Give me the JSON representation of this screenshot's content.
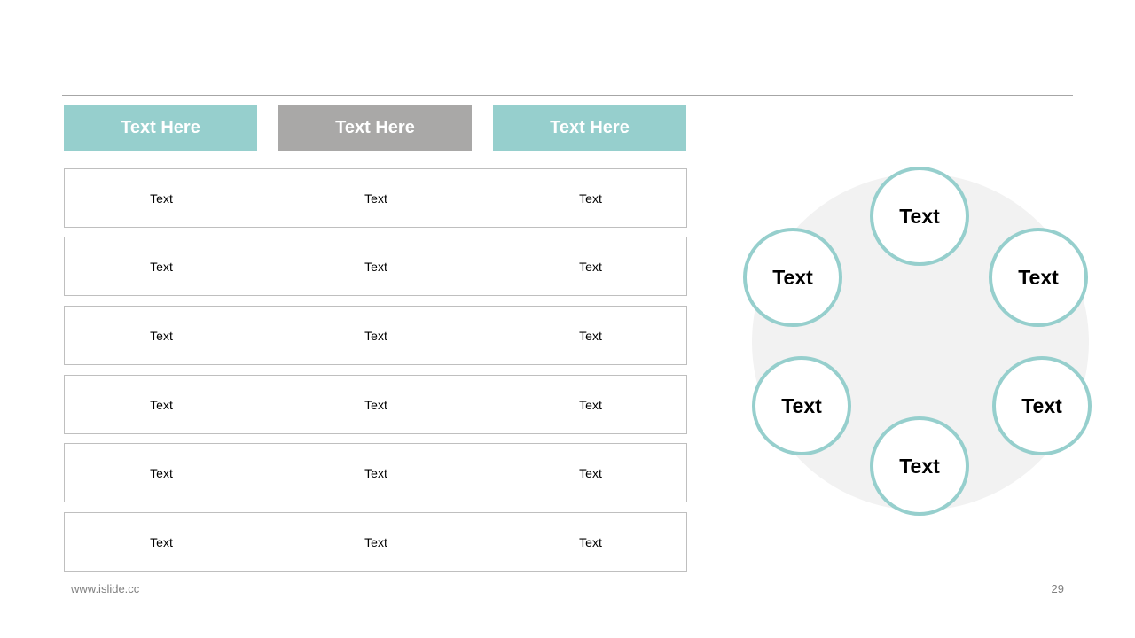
{
  "colors": {
    "teal": "#96cfcd",
    "gray": "#a9a8a7",
    "disc": "#f2f2f2"
  },
  "headers": [
    {
      "label": "Text Here",
      "color": "#96cfcd"
    },
    {
      "label": "Text Here",
      "color": "#a9a8a7"
    },
    {
      "label": "Text Here",
      "color": "#96cfcd"
    }
  ],
  "rows": [
    [
      "Text",
      "Text",
      "Text"
    ],
    [
      "Text",
      "Text",
      "Text"
    ],
    [
      "Text",
      "Text",
      "Text"
    ],
    [
      "Text",
      "Text",
      "Text"
    ],
    [
      "Text",
      "Text",
      "Text"
    ],
    [
      "Text",
      "Text",
      "Text"
    ]
  ],
  "cycle": {
    "nodes": [
      "Text",
      "Text",
      "Text",
      "Text",
      "Text",
      "Text"
    ]
  },
  "footer": {
    "url": "www.islide.cc",
    "page": "29"
  }
}
